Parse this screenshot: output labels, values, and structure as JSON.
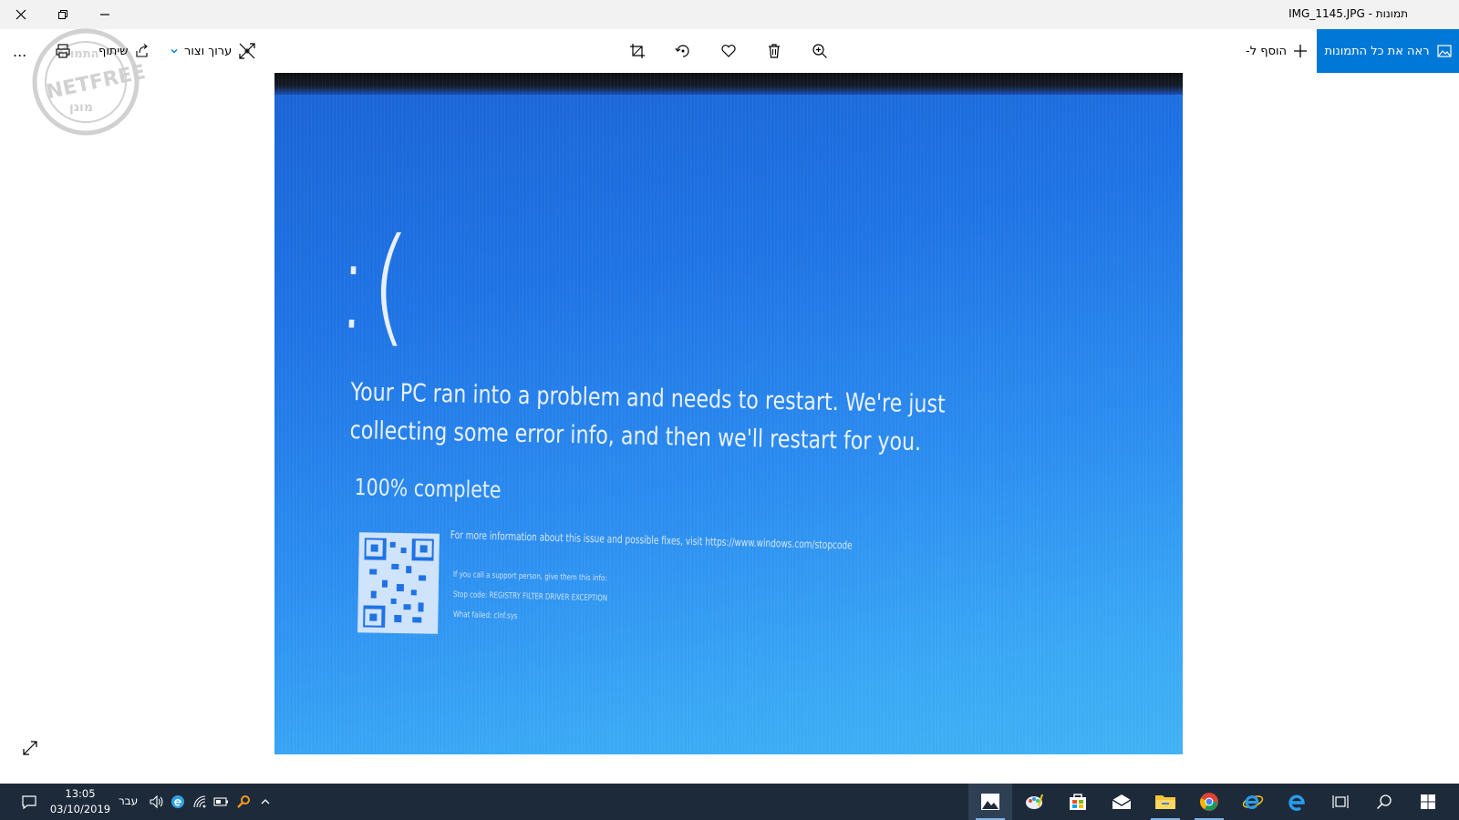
{
  "window": {
    "title": "תמונות - IMG_1145.JPG"
  },
  "toolbar": {
    "see_all_label": "ראה את כל התמונות",
    "add_to_label": "הוסף ל-",
    "edit_create_label": "ערוך וצור",
    "share_label": "שיתוף",
    "more_label": "..."
  },
  "watermark": {
    "brand": "NETFREE",
    "top_text": "התמונה",
    "bottom_text": "מוגן"
  },
  "photo": {
    "face": ":(",
    "message": "Your PC ran into a problem and needs to restart. We're just collecting some error info, and then we'll restart for you.",
    "progress": "100% complete",
    "more_info": "For more information about this issue and possible fixes, visit https://www.windows.com/stopcode",
    "support_line": "If you call a support person, give them this info:",
    "stop_code": "Stop code: REGISTRY FILTER DRIVER EXCEPTION",
    "what_failed": "What failed: clnf.sys"
  },
  "taskbar": {
    "time": "13:05",
    "date": "03/10/2019",
    "language": "עבר"
  },
  "colors": {
    "accent": "#0078d7",
    "taskbar_bg": "#1d2a3a",
    "bsod_blue": "#1f73e4"
  },
  "icons": {
    "title": [
      "close-icon",
      "restore-icon",
      "minimize-icon"
    ],
    "toolbar": [
      "crop-icon",
      "rotate-icon",
      "heart-icon",
      "delete-icon",
      "zoom-in-icon",
      "print-icon",
      "share-icon",
      "edit-create-icon",
      "plus-icon",
      "photos-icon"
    ],
    "taskbar": [
      "notification-icon",
      "volume-icon",
      "network-icon",
      "battery-icon",
      "chevron-up-icon",
      "photos-app-icon",
      "paint-3d-icon",
      "store-icon",
      "mail-icon",
      "file-explorer-icon",
      "chrome-icon",
      "ie-icon",
      "edge-icon",
      "task-view-icon",
      "search-icon",
      "start-icon"
    ]
  }
}
